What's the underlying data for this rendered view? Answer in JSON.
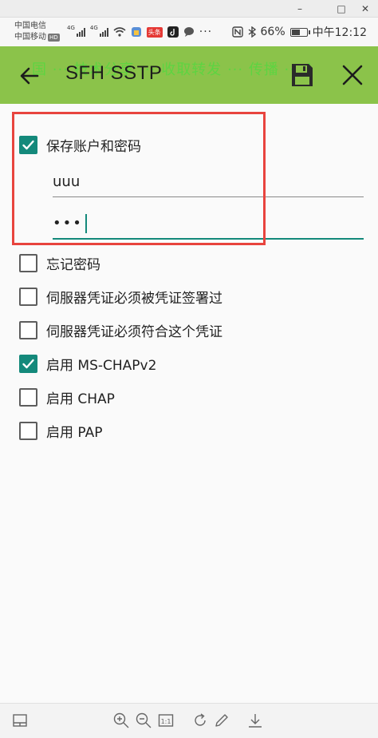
{
  "window": {
    "minimize": "–",
    "maximize": "□",
    "close": "✕"
  },
  "status_bar": {
    "carrier1": "中国电信",
    "carrier2": "中国移动",
    "hd_badge": "HD",
    "net_type": "4G",
    "net_type2": "4G",
    "battery_percent": "66%",
    "battery_level": 0.66,
    "time": "中午12:12",
    "badge_text": "头条"
  },
  "app_bar": {
    "title": "SFH  SSTP",
    "banner_text": "国 ··· 技术分享 ··· 收取转发 ··· 传播 ··· ！"
  },
  "form": {
    "save_credentials": {
      "label": "保存账户和密码",
      "checked": true
    },
    "username_value": "uuu",
    "password_value": "•••",
    "options": [
      {
        "label": "忘记密码",
        "checked": false
      },
      {
        "label": "伺服器凭证必须被凭证签署过",
        "checked": false
      },
      {
        "label": "伺服器凭证必须符合这个凭证",
        "checked": false
      },
      {
        "label": "启用 MS-CHAPv2",
        "checked": true
      },
      {
        "label": "启用 CHAP",
        "checked": false
      },
      {
        "label": "启用 PAP",
        "checked": false
      }
    ]
  },
  "colors": {
    "app_bar": "#8bc34a",
    "accent": "#14897b",
    "highlight": "#e8443e"
  },
  "toolbar_icons": [
    "layout-icon",
    "zoom-in-icon",
    "zoom-out-icon",
    "actual-size-icon",
    "rotate-icon",
    "edit-icon",
    "download-icon"
  ],
  "toolbar": {
    "actual_size_label": "1:1"
  }
}
